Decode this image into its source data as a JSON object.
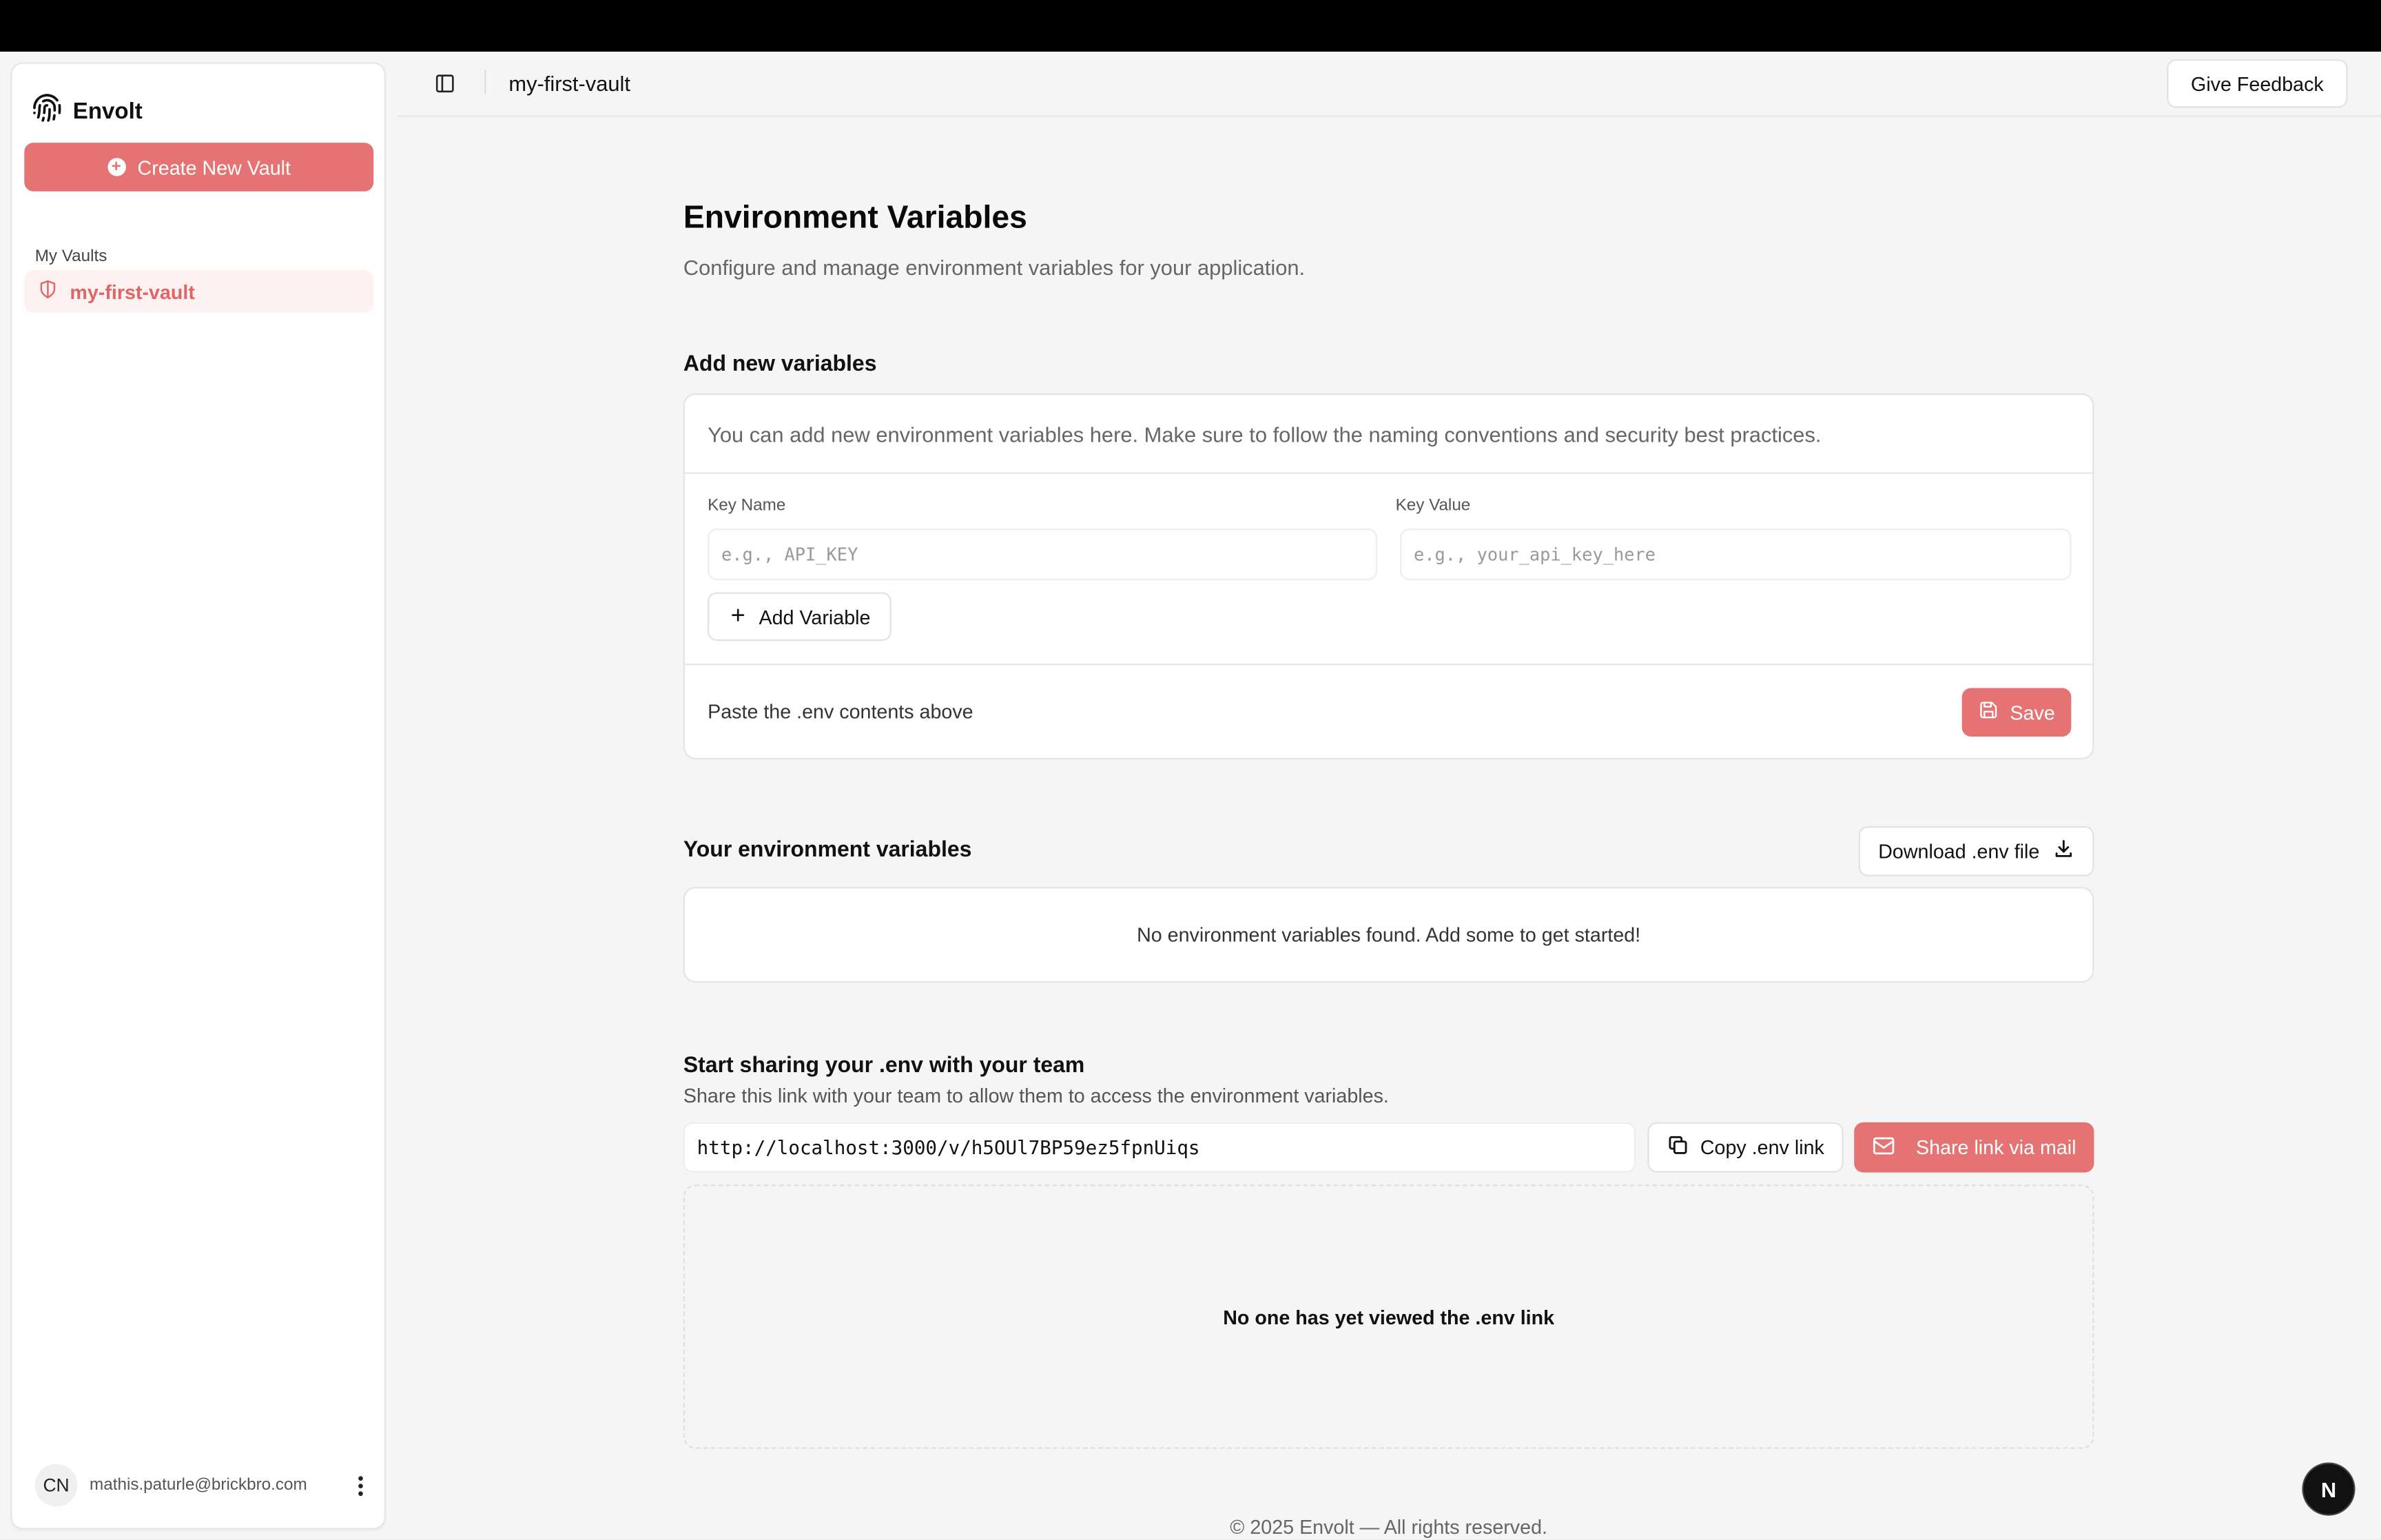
{
  "sidebar": {
    "brand": "Envolt",
    "create_button": "Create New Vault",
    "section_label": "My Vaults",
    "vaults": [
      {
        "label": "my-first-vault"
      }
    ],
    "user": {
      "initials": "CN",
      "email": "mathis.paturle@brickbro.com"
    }
  },
  "header": {
    "title": "my-first-vault",
    "feedback_button": "Give Feedback"
  },
  "main": {
    "title": "Environment Variables",
    "subtitle": "Configure and manage environment variables for your application.",
    "add_section": {
      "heading": "Add new variables",
      "description": "You can add new environment variables here. Make sure to follow the naming conventions and security best practices.",
      "key_name_label": "Key Name",
      "key_name_placeholder": "e.g., API_KEY",
      "key_value_label": "Key Value",
      "key_value_placeholder": "e.g., your_api_key_here",
      "add_button": "Add Variable",
      "paste_hint": "Paste the .env contents above",
      "save_button": "Save"
    },
    "env_section": {
      "heading": "Your environment variables",
      "download_button": "Download .env file",
      "empty_text": "No environment variables found. Add some to get started!"
    },
    "share_section": {
      "heading": "Start sharing your .env with your team",
      "subtitle": "Share this link with your team to allow them to access the environment variables.",
      "link": "http://localhost:3000/v/h5OUl7BP59ez5fpnUiqs",
      "copy_button": "Copy .env link",
      "mail_button": "Share link via mail",
      "viewers_empty": "No one has yet viewed the .env link"
    },
    "footer": "© 2025 Envolt — All rights reserved."
  },
  "badge": {
    "letter": "N"
  },
  "colors": {
    "accent": "#e57373",
    "accent_text": "#e06666",
    "background": "#f5f5f5"
  }
}
